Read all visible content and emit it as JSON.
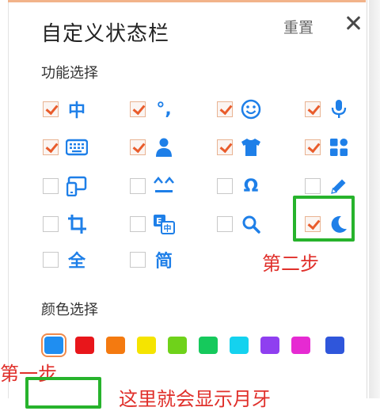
{
  "header": {
    "title": "自定义状态栏",
    "reset_label": "重置"
  },
  "features": {
    "section_label": "功能选择",
    "items": [
      {
        "checked": true,
        "icon": "chinese-mode-icon",
        "text": "中"
      },
      {
        "checked": true,
        "icon": "punctuation-icon",
        "text": "°,"
      },
      {
        "checked": true,
        "icon": "emoji-icon",
        "text": ""
      },
      {
        "checked": true,
        "icon": "microphone-icon",
        "text": ""
      },
      {
        "checked": true,
        "icon": "keyboard-icon",
        "text": ""
      },
      {
        "checked": true,
        "icon": "user-icon",
        "text": ""
      },
      {
        "checked": true,
        "icon": "skin-tshirt-icon",
        "text": ""
      },
      {
        "checked": true,
        "icon": "toolbox-grid-icon",
        "text": ""
      },
      {
        "checked": false,
        "icon": "devices-icon",
        "text": ""
      },
      {
        "checked": false,
        "icon": "emoticon-face-icon",
        "text": "^_^"
      },
      {
        "checked": false,
        "icon": "special-symbol-icon",
        "text": "Ω"
      },
      {
        "checked": false,
        "icon": "pen-handwriting-icon",
        "text": ""
      },
      {
        "checked": false,
        "icon": "crop-screenshot-icon",
        "text": ""
      },
      {
        "checked": false,
        "icon": "translate-icon",
        "text": ""
      },
      {
        "checked": false,
        "icon": "search-icon",
        "text": ""
      },
      {
        "checked": true,
        "icon": "moon-icon",
        "text": ""
      },
      {
        "checked": false,
        "icon": "full-width-icon",
        "text": "全"
      },
      {
        "checked": false,
        "icon": "simplified-icon",
        "text": "简"
      }
    ]
  },
  "colors": {
    "section_label": "颜色选择",
    "selected_index": 0,
    "swatches": [
      "#1f8ef1",
      "#e8161b",
      "#f47a10",
      "#f5e400",
      "#6fd21a",
      "#16c95c",
      "#14d2ef",
      "#8f3ff0",
      "#e62ad2",
      "#2f56db"
    ]
  },
  "annotations": {
    "step2": "第二步",
    "step1": "第一步",
    "note": "这里就会显示月牙"
  },
  "style": {
    "accent": "#1e7fe8",
    "check": "#e95c2c",
    "highlight_box": "#27b32c",
    "annotation_text": "#e0302b"
  }
}
